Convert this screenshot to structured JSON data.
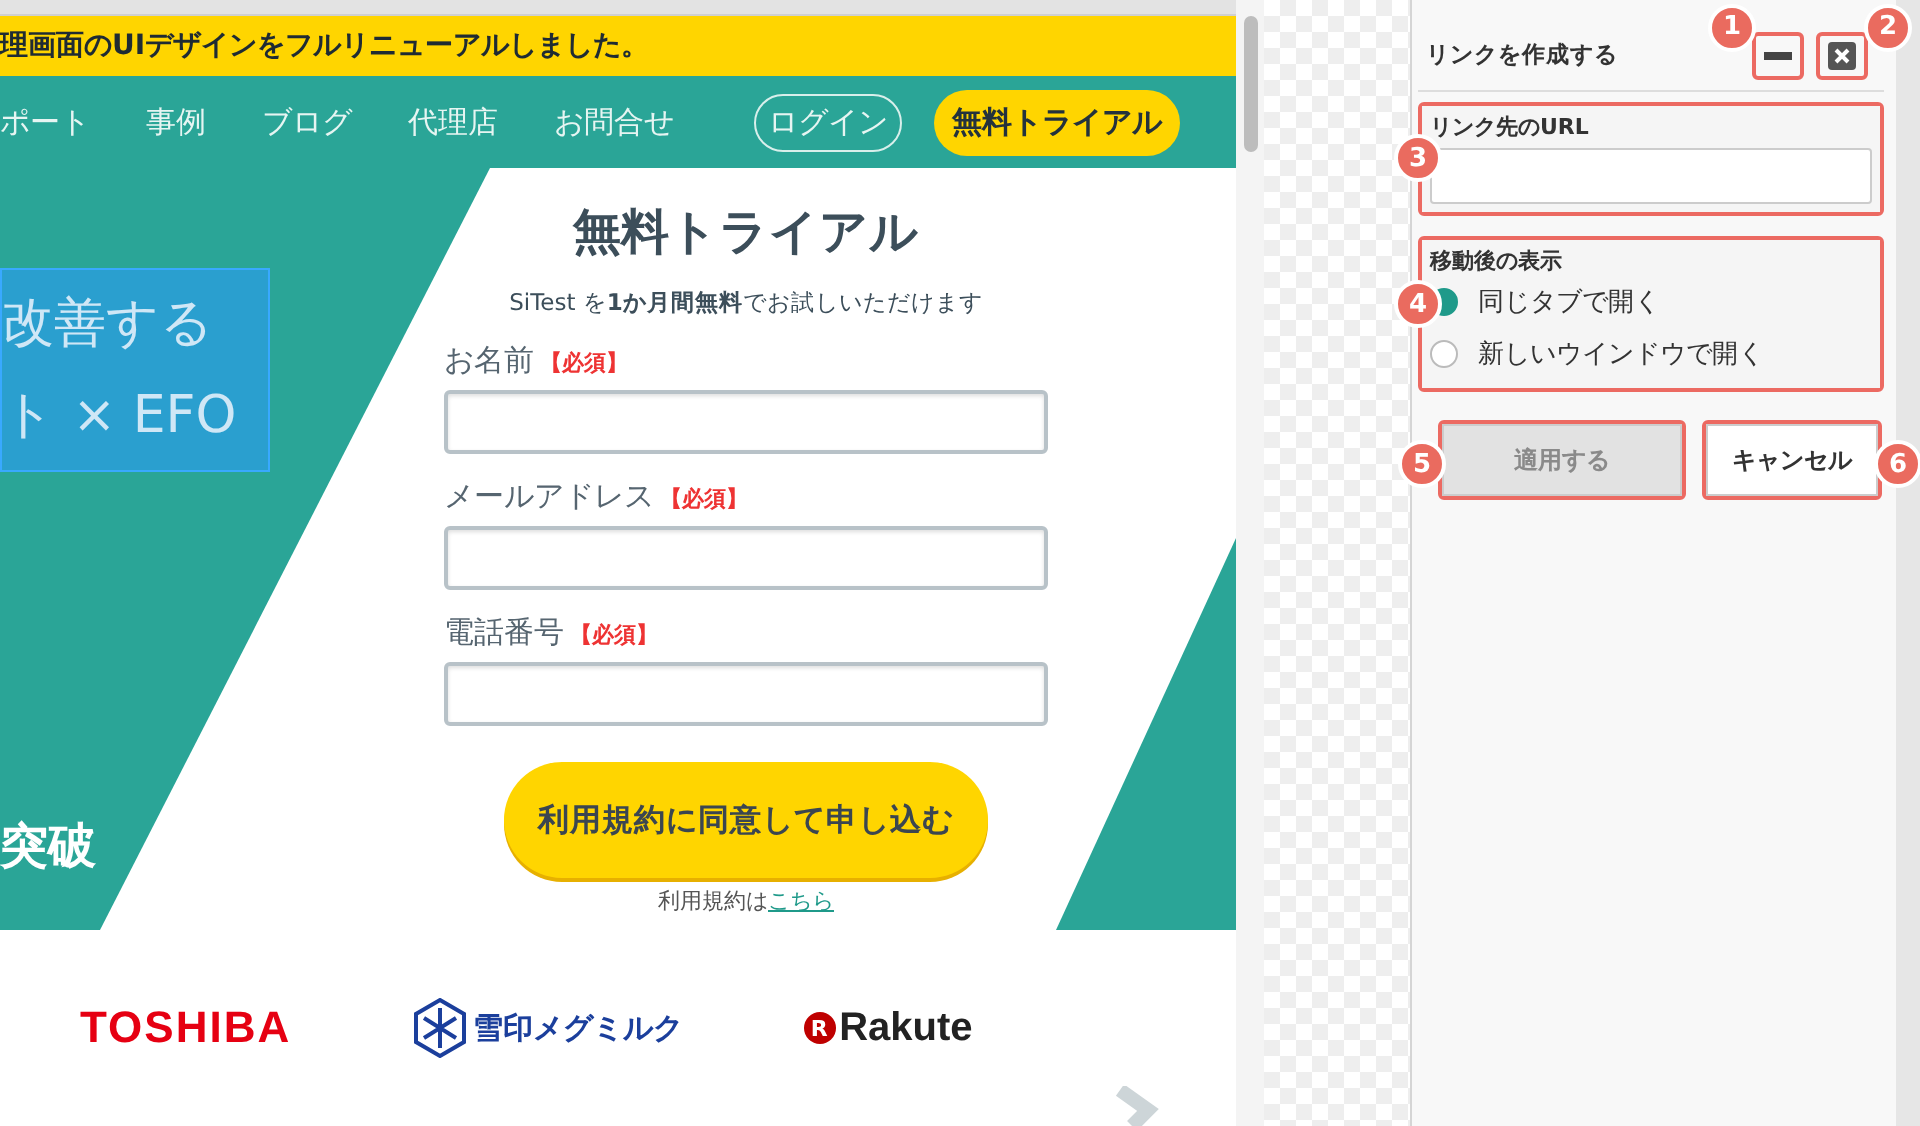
{
  "banner": {
    "text": "理画面のUIデザインをフルリニューアルしました。"
  },
  "nav": {
    "items": [
      "ポート",
      "事例",
      "ブログ",
      "代理店",
      "お問合せ"
    ],
    "login": "ログイン",
    "trial": "無料トライアル"
  },
  "hero": {
    "headline_lines": [
      "改善する",
      "ト × EFO"
    ],
    "highlighted": true,
    "tagline": "突破"
  },
  "form": {
    "title": "無料トライアル",
    "subtitle": "SiTest を**1か月間無料**でお試しいただけます",
    "fields": [
      {
        "label": "お名前",
        "required": "【必須】"
      },
      {
        "label": "メールアドレス",
        "required": "【必須】"
      },
      {
        "label": "電話番号",
        "required": "【必須】"
      }
    ],
    "submit": "利用規約に同意して申し込む",
    "terms_text": "利用規約は",
    "terms_link": "こちら"
  },
  "logos": [
    {
      "kind": "toshiba",
      "text": "TOSHIBA"
    },
    {
      "kind": "snow",
      "text": "雪印メグミルク"
    },
    {
      "kind": "rakuten",
      "mark": "R",
      "text": "Rakute"
    }
  ],
  "dialog": {
    "title": "リンクを作成する",
    "minimize": {
      "callout": "1"
    },
    "close": {
      "callout": "2"
    },
    "url_group": {
      "label": "リンク先のURL",
      "callout": "3"
    },
    "target_group": {
      "label": "移動後の表示",
      "callout": "4",
      "options": [
        {
          "label": "同じタブで開く",
          "selected": true
        },
        {
          "label": "新しいウインドウで開く",
          "selected": false
        }
      ]
    },
    "buttons": [
      {
        "label": "適用する",
        "disabled": true,
        "callout": "5"
      },
      {
        "label": "キャンセル",
        "disabled": false,
        "callout": "6"
      }
    ]
  }
}
